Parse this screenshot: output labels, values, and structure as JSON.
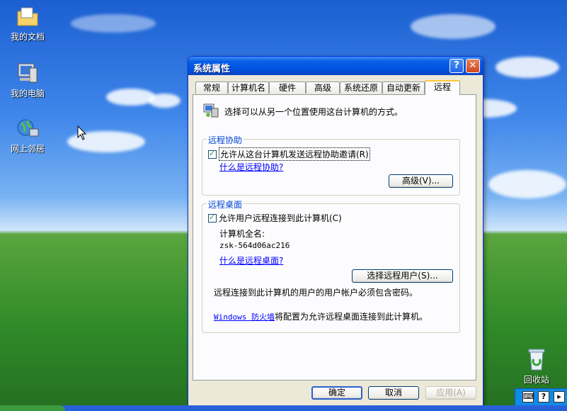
{
  "desktop": {
    "icons": [
      {
        "label": "我的文档"
      },
      {
        "label": "我的电脑"
      },
      {
        "label": "网上邻居"
      },
      {
        "label": "回收站"
      }
    ]
  },
  "window": {
    "title": "系统属性",
    "help_glyph": "?",
    "close_glyph": "✕",
    "tabs": [
      {
        "label": "常规"
      },
      {
        "label": "计算机名"
      },
      {
        "label": "硬件"
      },
      {
        "label": "高级"
      },
      {
        "label": "系统还原"
      },
      {
        "label": "自动更新"
      },
      {
        "label": "远程"
      }
    ],
    "intro_text": "选择可以从另一个位置使用这台计算机的方式。",
    "remote_assistance": {
      "group_title": "远程协助",
      "checkbox_label": "允许从这台计算机发送远程协助邀请(R)",
      "checked": true,
      "link": "什么是远程协助?",
      "advanced_button": "高级(V)..."
    },
    "remote_desktop": {
      "group_title": "远程桌面",
      "checkbox_label": "允许用户远程连接到此计算机(C)",
      "checked": true,
      "full_name_label": "计算机全名:",
      "full_name_value": "zsk-564d06ac216",
      "link": "什么是远程桌面?",
      "select_users_button": "选择远程用户(S)...",
      "password_note": "远程连接到此计算机的用户的用户帐户必须包含密码。",
      "firewall_link": "Windows 防火墙",
      "firewall_text": "将配置为允许远程桌面连接到此计算机。"
    },
    "buttons": {
      "ok": "确定",
      "cancel": "取消",
      "apply": "应用(A)"
    }
  },
  "tray": {
    "help_glyph": "?"
  }
}
